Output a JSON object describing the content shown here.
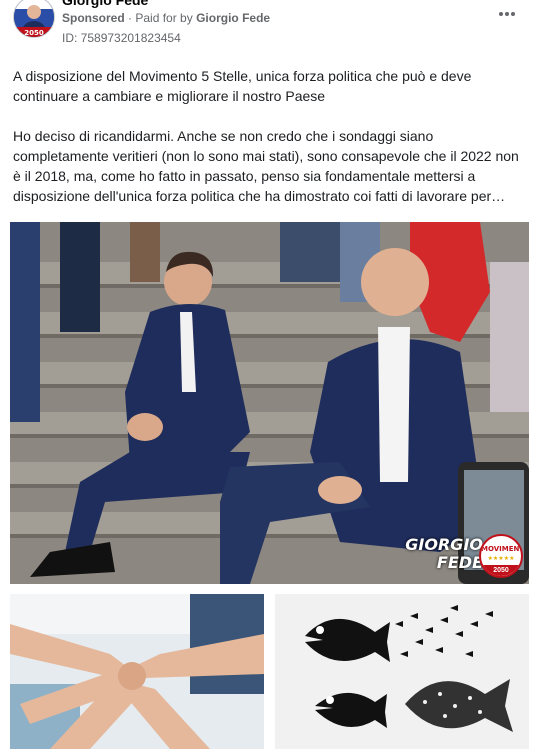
{
  "post": {
    "author": "Giorgio Fede",
    "sponsored": "Sponsored",
    "separator": "·",
    "paid_for_prefix": "Paid for by",
    "paid_for_name": "Giorgio Fede",
    "ad_id": "ID: 758973201823454",
    "more_icon": "ellipsis-icon",
    "paragraph_1": "A disposizione del Movimento 5 Stelle, unica forza politica che può e deve continuare a cambiare e migliorare il nostro Paese",
    "paragraph_2": "Ho deciso di ricandidarmi. Anche se non credo che i sondaggi siano completamente veritieri (non lo sono mai stati), sono consapevole che il 2022 non è il 2018, ma, come ho fatto in passato, penso sia fondamentale mettersi a disposizione dell'unica forza politica che ha dimostrato coi fatti di lavorare per…"
  },
  "avatar": {
    "badge": "2050"
  },
  "media": {
    "brand_line_1": "GIORGIO",
    "brand_line_2": "FEDE",
    "logo_top": "MOVIMENTO",
    "logo_stars": "★★★★★",
    "logo_bottom": "2050"
  },
  "colors": {
    "text": "#1c1e21",
    "muted": "#65676b",
    "brand_red": "#c0101a",
    "suit_navy": "#1f2d5c"
  }
}
